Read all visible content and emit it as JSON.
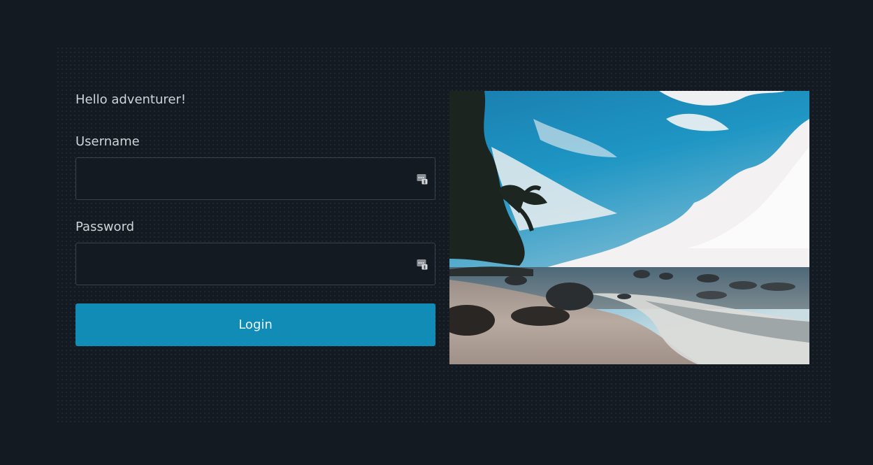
{
  "login": {
    "greeting": "Hello adventurer!",
    "username_label": "Username",
    "username_value": "",
    "password_label": "Password",
    "password_value": "",
    "submit_label": "Login"
  },
  "hero_image": {
    "icon": "beach-photo"
  },
  "colors": {
    "background": "#141a22",
    "accent": "#118cb7",
    "input_border": "#3a424c"
  }
}
